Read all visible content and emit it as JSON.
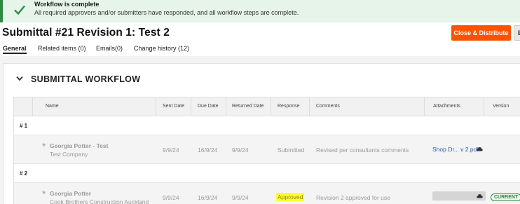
{
  "banner": {
    "title": "Workflow is complete",
    "message": "All required approvers and/or submitters have responded, and all workflow steps are complete.",
    "icon": "check-icon",
    "color": "#2e8b47"
  },
  "page": {
    "title": "Submittal #21 Revision 1: Test 2"
  },
  "toolbar": {
    "primary_label": "Close & Distribute",
    "primary_color": "#ff5200",
    "secondary_label": "E"
  },
  "tabs": [
    {
      "label": "General"
    },
    {
      "label": "Related items (0)"
    },
    {
      "label": "Emails(0)"
    },
    {
      "label": "Change history (12)"
    }
  ],
  "workflow": {
    "section_title": "SUBMITTAL WORKFLOW",
    "columns": [
      "Name",
      "Sent Date",
      "Due Date",
      "Returned Date",
      "Response",
      "Comments",
      "Attachments",
      "Version"
    ],
    "groups": [
      {
        "label": "# 1",
        "rows": [
          {
            "name": "Georgia Potter - Test",
            "company": "Test Company",
            "sent": "9/9/24",
            "due": "16/9/24",
            "returned": "9/9/24",
            "response": "Submitted",
            "comments": "Revised per consultants comments",
            "attachment": "Shop Dr... v 2.pdf"
          }
        ]
      },
      {
        "label": "# 2",
        "rows": [
          {
            "name": "Georgia Potter",
            "company": "Cook Brothers Construction Auckland",
            "sent": "9/9/24",
            "due": "16/9/24",
            "returned": "9/9/24",
            "response": "Approved",
            "comments": "Revision 2 approved for use",
            "version": "CURRENT"
          }
        ]
      }
    ]
  }
}
